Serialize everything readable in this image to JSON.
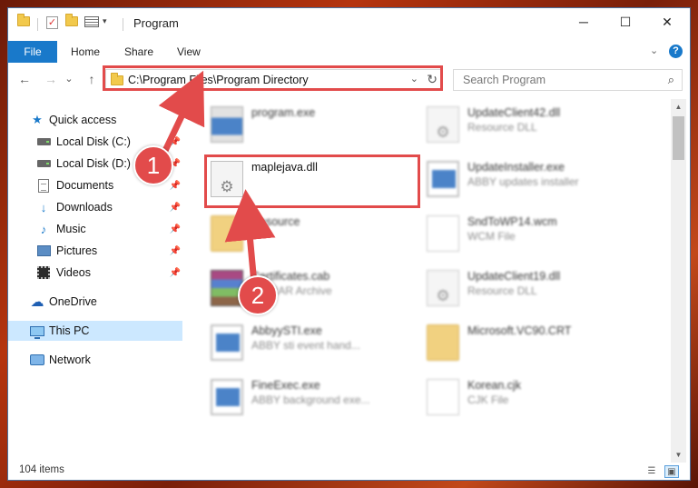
{
  "window": {
    "title": "Program"
  },
  "title_controls": {
    "minimize": "─",
    "maximize": "☐",
    "close": "✕"
  },
  "ribbon": {
    "tabs": [
      "File",
      "Home",
      "Share",
      "View"
    ],
    "expand_icon": "chevron-down-icon",
    "help_label": "?"
  },
  "nav_buttons": {
    "back": "←",
    "forward": "→",
    "history": "⌄",
    "up": "↑"
  },
  "address": {
    "path": "C:\\Program Files\\Program Directory",
    "dropdown": "⌄",
    "refresh": "↻"
  },
  "search": {
    "placeholder": "Search Program",
    "icon": "⌕"
  },
  "nav_pane": {
    "items": [
      {
        "label": "Quick access",
        "icon": "star-icon",
        "pinned": false
      },
      {
        "label": "Local Disk (C:)",
        "icon": "drive-icon",
        "pinned": true
      },
      {
        "label": "Local Disk (D:)",
        "icon": "drive-icon",
        "pinned": true
      },
      {
        "label": "Documents",
        "icon": "documents-icon",
        "pinned": true
      },
      {
        "label": "Downloads",
        "icon": "download-icon",
        "pinned": true
      },
      {
        "label": "Music",
        "icon": "music-icon",
        "pinned": true
      },
      {
        "label": "Pictures",
        "icon": "pictures-icon",
        "pinned": true
      },
      {
        "label": "Videos",
        "icon": "videos-icon",
        "pinned": true
      },
      {
        "label": "OneDrive",
        "icon": "cloud-icon",
        "pinned": false
      },
      {
        "label": "This PC",
        "icon": "computer-icon",
        "pinned": false,
        "selected": true
      },
      {
        "label": "Network",
        "icon": "network-icon",
        "pinned": false
      }
    ]
  },
  "files": {
    "left": [
      {
        "name": "program.exe",
        "desc": "",
        "icon": "setup-app-icon",
        "blurred": true
      },
      {
        "name": "maplejava.dll",
        "desc": "",
        "icon": "dll-gear-icon",
        "blurred": false,
        "highlighted": true
      },
      {
        "name": "Resource",
        "desc": "",
        "icon": "folder-icon",
        "blurred": true
      },
      {
        "name": "Certificates.cab",
        "desc": "WinRAR Archive",
        "icon": "winrar-icon",
        "blurred": true
      },
      {
        "name": "AbbyySTI.exe",
        "desc": "ABBY sti event hand...",
        "icon": "app-icon",
        "blurred": true
      },
      {
        "name": "FineExec.exe",
        "desc": "ABBY background exe...",
        "icon": "app-icon",
        "blurred": true
      }
    ],
    "right": [
      {
        "name": "UpdateClient42.dll",
        "desc": "Resource DLL",
        "icon": "dll-gear-icon",
        "blurred": true
      },
      {
        "name": "UpdateInstaller.exe",
        "desc": "ABBY updates installer",
        "icon": "app-icon",
        "blurred": true
      },
      {
        "name": "SndToWP14.wcm",
        "desc": "WCM File",
        "icon": "generic-file-icon",
        "blurred": true
      },
      {
        "name": "UpdateClient19.dll",
        "desc": "Resource DLL",
        "icon": "dll-gear-icon",
        "blurred": true
      },
      {
        "name": "Microsoft.VC90.CRT",
        "desc": "",
        "icon": "folder-icon",
        "blurred": true
      },
      {
        "name": "Korean.cjk",
        "desc": "CJK File",
        "icon": "generic-file-icon",
        "blurred": true
      }
    ]
  },
  "status": {
    "item_count": "104 items",
    "details_view": "☰",
    "large_icons_view": "▣"
  },
  "scrollbar": {
    "up": "▲",
    "down": "▼"
  },
  "callouts": [
    "1",
    "2"
  ],
  "colors": {
    "accent": "#1979ca",
    "callout": "#e24b4b",
    "selection": "#cce8ff"
  }
}
